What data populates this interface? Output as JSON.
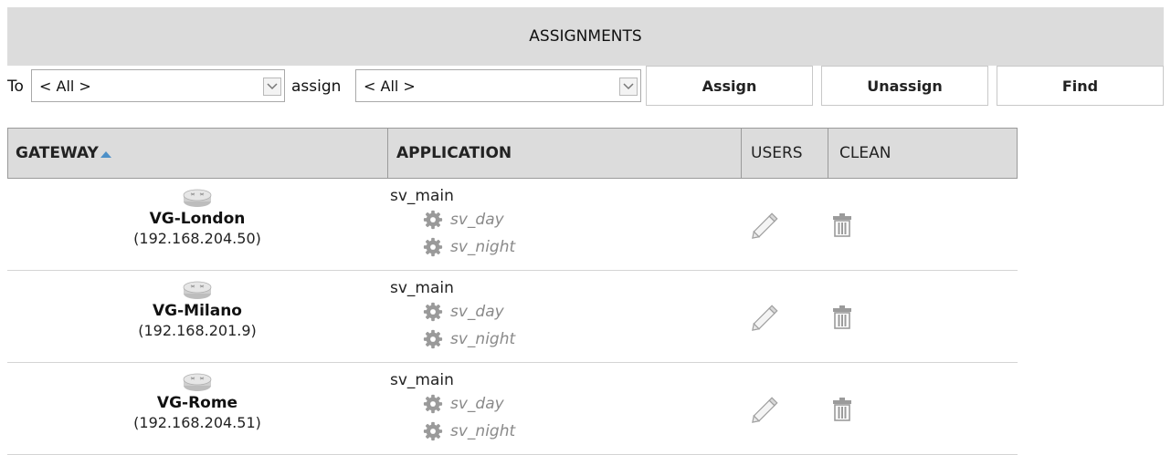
{
  "header": {
    "title": "ASSIGNMENTS"
  },
  "toolbar": {
    "to_label": "To",
    "to_select": {
      "value": "< All >"
    },
    "assign_label": "assign",
    "assign_select": {
      "value": "< All >"
    },
    "assign_button": "Assign",
    "unassign_button": "Unassign",
    "find_button": "Find"
  },
  "table": {
    "columns": {
      "gateway": "GATEWAY",
      "application": "APPLICATION",
      "users": "USERS",
      "clean": "CLEAN"
    },
    "sort": {
      "column": "gateway",
      "direction": "ascending"
    },
    "rows": [
      {
        "gateway": "VG-London",
        "ip": "(192.168.204.50)",
        "app": "sv_main",
        "sub_apps": [
          "sv_day",
          "sv_night"
        ]
      },
      {
        "gateway": "VG-Milano",
        "ip": "(192.168.201.9)",
        "app": "sv_main",
        "sub_apps": [
          "sv_day",
          "sv_night"
        ]
      },
      {
        "gateway": "VG-Rome",
        "ip": "(192.168.204.51)",
        "app": "sv_main",
        "sub_apps": [
          "sv_day",
          "sv_night"
        ]
      }
    ]
  },
  "icons": {
    "gateway": "router-icon",
    "sub_app": "gear-icon",
    "users": "pencil-icon",
    "clean": "trash-icon",
    "sort": "sort-ascending-icon",
    "dropdown": "chevron-down-icon"
  },
  "colors": {
    "header_bg": "#dcdcdc",
    "sort_arrow": "#4d90c8",
    "sub_app_text": "#8a8a8a"
  }
}
